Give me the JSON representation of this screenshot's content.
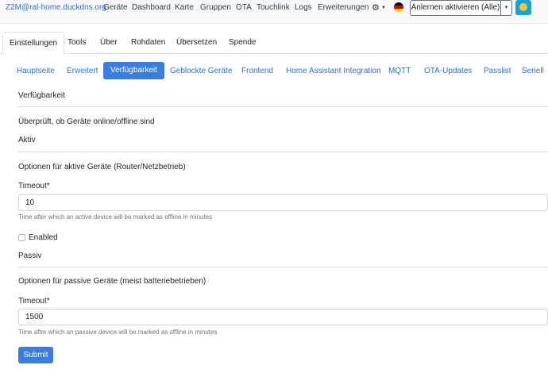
{
  "navbar": {
    "brand": "Z2M@ral-home.duckdns.org",
    "links": [
      "Geräte",
      "Dashboard",
      "Karte",
      "Gruppen",
      "OTA",
      "Touchlink",
      "Logs",
      "Erweiterungen"
    ],
    "settings_icon": "gear-icon",
    "language_flag": "germany-flag-icon",
    "permit_join_label": "Anlernen aktivieren (Alle)",
    "theme_icon": "smiley-icon"
  },
  "top_tabs": [
    "Einstellungen",
    "Tools",
    "Über",
    "Rohdaten",
    "Übersetzen",
    "Spende"
  ],
  "pills": [
    "Hauptseite",
    "Erweitert",
    "Verfügbarkeit",
    "Geblockte Geräte",
    "Frontend",
    "Home Assistant Integration",
    "MQTT",
    "OTA-Updates",
    "Passlist",
    "Seriell"
  ],
  "active_pill": "Verfügbarkeit",
  "form": {
    "title": "Verfügbarkeit",
    "description": "Überprüft, ob Geräte online/offline sind",
    "active": {
      "heading": "Aktiv",
      "description": "Optionen für aktive Geräte (Router/Netzbetrieb)",
      "timeout_label": "Timeout*",
      "timeout_value": "10",
      "timeout_help": "Time after which an active device will be marked as offline in minutes"
    },
    "enabled_label": "Enabled",
    "passive": {
      "heading": "Passiv",
      "description": "Optionen für passive Geräte (meist batteriebetrieben)",
      "timeout_label": "Timeout*",
      "timeout_value": "1500",
      "timeout_help": "Time after which an passive device will be marked as offline in minutes"
    },
    "submit_label": "Submit"
  },
  "colors": {
    "accent": "#3b7ddd",
    "link": "#2c6fd6",
    "navbar_bg": "#f8f9fa"
  }
}
